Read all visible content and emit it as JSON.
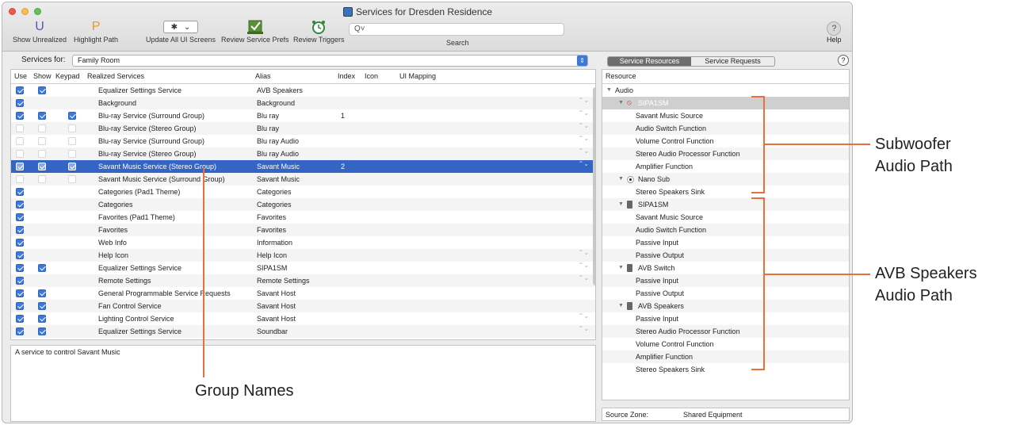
{
  "window": {
    "title": "Services for Dresden Residence"
  },
  "toolbar": {
    "show_unrealized": "Show Unrealized",
    "highlight_path": "Highlight Path",
    "update_all": "Update All UI Screens",
    "review_prefs": "Review Service Prefs",
    "review_triggers": "Review Triggers",
    "search_placeholder": "Q˅",
    "search_label": "Search",
    "help": "Help",
    "icon_u": "U",
    "icon_p": "P"
  },
  "services_for": {
    "label": "Services for:",
    "value": "Family Room"
  },
  "table": {
    "headers": {
      "use": "Use",
      "show": "Show",
      "keypad": "Keypad",
      "realized": "Realized Services",
      "alias": "Alias",
      "index": "Index",
      "icon": "Icon",
      "ui_mapping": "UI Mapping"
    },
    "rows": [
      {
        "use": true,
        "show": true,
        "keypad": null,
        "service": "Equalizer Settings Service",
        "alias": "AVB Speakers",
        "index": "",
        "stepper": false
      },
      {
        "use": true,
        "show": null,
        "keypad": null,
        "service": "Background",
        "alias": "Background",
        "index": "",
        "stepper": true
      },
      {
        "use": true,
        "show": true,
        "keypad": true,
        "service": "Blu-ray Service  (Surround Group)",
        "alias": "Blu ray",
        "index": "1",
        "stepper": true
      },
      {
        "use": false,
        "show": false,
        "keypad": false,
        "service": "Blu-ray Service  (Stereo Group)",
        "alias": "Blu ray",
        "index": "",
        "stepper": true
      },
      {
        "use": false,
        "show": false,
        "keypad": false,
        "service": "Blu-ray Service  (Surround Group)",
        "alias": "Blu ray Audio",
        "index": "",
        "stepper": true
      },
      {
        "use": false,
        "show": false,
        "keypad": false,
        "service": "Blu-ray Service  (Stereo Group)",
        "alias": "Blu ray Audio",
        "index": "",
        "stepper": true
      },
      {
        "use": true,
        "show": true,
        "keypad": true,
        "service": "Savant Music Service (Stereo Group)",
        "alias": "Savant Music",
        "index": "2",
        "stepper": true,
        "selected": true
      },
      {
        "use": false,
        "show": false,
        "keypad": false,
        "service": "Savant Music Service (Surround Group)",
        "alias": "Savant Music",
        "index": "",
        "stepper": false
      },
      {
        "use": true,
        "show": null,
        "keypad": null,
        "service": "Categories (Pad1 Theme)",
        "alias": "Categories",
        "index": "",
        "stepper": false
      },
      {
        "use": true,
        "show": null,
        "keypad": null,
        "service": "Categories",
        "alias": "Categories",
        "index": "",
        "stepper": false
      },
      {
        "use": true,
        "show": null,
        "keypad": null,
        "service": "Favorites (Pad1 Theme)",
        "alias": "Favorites",
        "index": "",
        "stepper": false
      },
      {
        "use": true,
        "show": null,
        "keypad": null,
        "service": "Favorites",
        "alias": "Favorites",
        "index": "",
        "stepper": false
      },
      {
        "use": true,
        "show": null,
        "keypad": null,
        "service": "Web Info",
        "alias": "Information",
        "index": "",
        "stepper": false
      },
      {
        "use": true,
        "show": null,
        "keypad": null,
        "service": "Help Icon",
        "alias": "Help Icon",
        "index": "",
        "stepper": true
      },
      {
        "use": true,
        "show": true,
        "keypad": null,
        "service": "Equalizer Settings  Service",
        "alias": "SIPA1SM",
        "index": "",
        "stepper": true
      },
      {
        "use": true,
        "show": null,
        "keypad": null,
        "service": "Remote Settings",
        "alias": "Remote Settings",
        "index": "",
        "stepper": true
      },
      {
        "use": true,
        "show": true,
        "keypad": null,
        "service": "General Programmable Service Requests",
        "alias": "Savant Host",
        "index": "",
        "stepper": false
      },
      {
        "use": true,
        "show": true,
        "keypad": null,
        "service": "Fan Control Service",
        "alias": "Savant Host",
        "index": "",
        "stepper": false
      },
      {
        "use": true,
        "show": true,
        "keypad": null,
        "service": "Lighting Control Service",
        "alias": "Savant Host",
        "index": "",
        "stepper": true
      },
      {
        "use": true,
        "show": true,
        "keypad": null,
        "service": "Equalizer Settings  Service",
        "alias": "Soundbar",
        "index": "",
        "stepper": true
      }
    ]
  },
  "description": "A service to control Savant Music",
  "tabs": {
    "resources": "Service Resources",
    "requests": "Service Requests"
  },
  "resources": {
    "header": "Resource",
    "rows": [
      {
        "level": 0,
        "text": "Audio",
        "toggle": true,
        "icon": ""
      },
      {
        "level": 1,
        "text": "SIPA1SM",
        "toggle": true,
        "icon": "speaker-icon",
        "highlight": true
      },
      {
        "level": 2,
        "text": "Savant Music Source"
      },
      {
        "level": 2,
        "text": "Audio Switch Function"
      },
      {
        "level": 2,
        "text": "Volume Control Function"
      },
      {
        "level": 2,
        "text": "Stereo Audio Processor Function"
      },
      {
        "level": 2,
        "text": "Amplifier Function"
      },
      {
        "level": 1,
        "text": "Nano Sub",
        "toggle": true,
        "icon": "sub-icon"
      },
      {
        "level": 2,
        "text": "Stereo Speakers Sink"
      },
      {
        "level": 1,
        "text": "SIPA1SM",
        "toggle": true,
        "icon": "device-icon"
      },
      {
        "level": 2,
        "text": "Savant Music Source"
      },
      {
        "level": 2,
        "text": "Audio Switch Function"
      },
      {
        "level": 2,
        "text": "Passive Input"
      },
      {
        "level": 2,
        "text": "Passive Output"
      },
      {
        "level": 1,
        "text": "AVB Switch",
        "toggle": true,
        "icon": "device-icon"
      },
      {
        "level": 2,
        "text": "Passive Input"
      },
      {
        "level": 2,
        "text": "Passive Output"
      },
      {
        "level": 1,
        "text": "AVB Speakers",
        "toggle": true,
        "icon": "device-icon"
      },
      {
        "level": 2,
        "text": "Passive Input"
      },
      {
        "level": 2,
        "text": "Stereo Audio Processor Function"
      },
      {
        "level": 2,
        "text": "Volume Control Function"
      },
      {
        "level": 2,
        "text": "Amplifier Function"
      },
      {
        "level": 2,
        "text": "Stereo Speakers Sink"
      }
    ]
  },
  "zone": {
    "label": "Source Zone:",
    "value": "Shared Equipment"
  },
  "annotations": {
    "subwoofer": "Subwoofer\nAudio Path",
    "avb": "AVB Speakers\nAudio Path",
    "group": "Group Names"
  },
  "colors": {
    "accent": "#3465c4",
    "callout": "#e8703a"
  }
}
